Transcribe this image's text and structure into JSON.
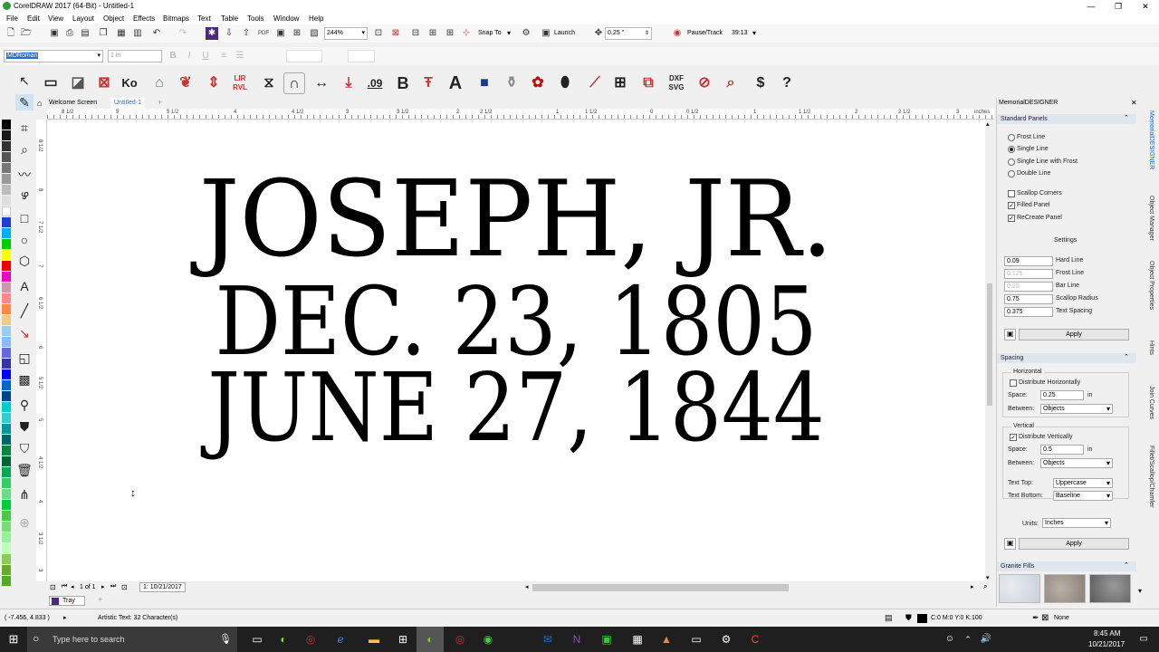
{
  "title": "CorelDRAW 2017 (64-Bit) - Untitled-1",
  "menu": [
    "File",
    "Edit",
    "View",
    "Layout",
    "Object",
    "Effects",
    "Bitmaps",
    "Text",
    "Table",
    "Tools",
    "Window",
    "Help"
  ],
  "std": {
    "zoom": "244%",
    "snap": "Snap To",
    "launch": "Launch",
    "nudge": "0.25 \"",
    "pause": "Pause/Track",
    "pagecount": "39:13"
  },
  "prop": {
    "font": "MDRoman",
    "size": "1 in"
  },
  "tabs": {
    "welcome": "Welcome Screen",
    "doc": "Untitled-1"
  },
  "ruler_h": [
    "8",
    "8 1/2",
    "5",
    "5 1/2",
    "4",
    "4 1/2",
    "3",
    "3 1/2",
    "2",
    "2 1/2",
    "1",
    "1 1/2",
    "0",
    "0 1/2",
    "1",
    "1 1/2",
    "2",
    "2 1/2",
    "3",
    "inches"
  ],
  "ruler_v": [
    "8 1/2",
    "8",
    "7 1/2",
    "7",
    "6 1/2",
    "6",
    "5 1/2",
    "5",
    "4 1/2",
    "4",
    "3 1/2",
    "3"
  ],
  "engraving": {
    "line1": "JOSEPH, JR.",
    "line2": "DEC. 23, 1805",
    "line3": "JUNE 27, 1844"
  },
  "page_nav": {
    "page_of": "1 of 1",
    "page_tab": "1: 10/21/2017"
  },
  "tray": "Tray",
  "panel": {
    "title": "MemorialDESIGNER",
    "standard_panels": "Standard Panels",
    "radios": [
      "Frost Line",
      "Single Line",
      "Single Line with Frost",
      "Double Line"
    ],
    "checks": [
      "Scallop Corners",
      "Filled Panel",
      "ReCreate Panel"
    ],
    "settings": "Settings",
    "rows": [
      {
        "v": "0.09",
        "l": "Hard Line"
      },
      {
        "v": "0.125",
        "l": "Frost Line"
      },
      {
        "v": "0.25",
        "l": "Bar Line"
      },
      {
        "v": "0.75",
        "l": "Scallop Radius"
      },
      {
        "v": "0.375",
        "l": "Text Spacing"
      }
    ],
    "apply": "Apply",
    "spacing": "Spacing",
    "horizontal": "Horizontal",
    "dist_h": "Distribute Horizontally",
    "space": "Space:",
    "space_h": "0.25",
    "in": "in",
    "between": "Between:",
    "objects": "Objects",
    "vertical": "Vertical",
    "dist_v": "Distribute Vertically",
    "space_v": "0.5",
    "text_top": "Text Top:",
    "uppercase": "Uppercase",
    "text_bottom": "Text Bottom:",
    "baseline": "Baseline",
    "units": "Units:",
    "inches": "Inches",
    "granite": "Granite Fills"
  },
  "sidetabs": [
    "MemorialDESIGNER",
    "Object Manager",
    "Object Properties",
    "Hints",
    "Join Curves",
    "Fillet/Scallop/Chamfer"
  ],
  "status": {
    "coords": "( -7.456, 4.833 )",
    "info": "Artistic Text: 32 Character(s)",
    "fill": "C:0 M:0 Y:0 K:100",
    "outline": "None"
  },
  "taskbar": {
    "search": "Type here to search",
    "time": "8:45 AM",
    "date": "10/21/2017"
  },
  "colors": {
    "accent": "#2a8bd6",
    "canvas": "#ffffff"
  }
}
